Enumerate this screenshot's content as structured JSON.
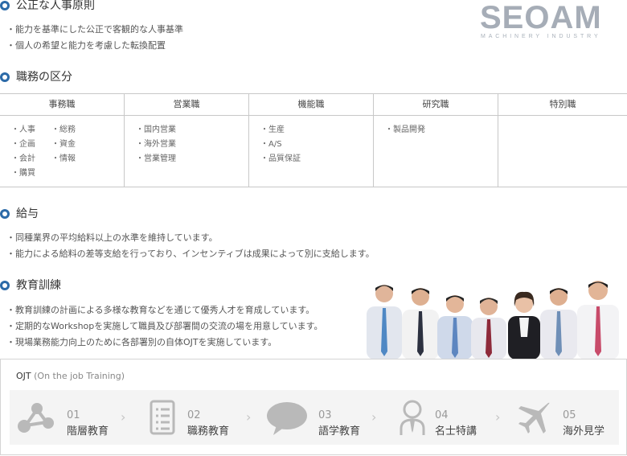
{
  "logo": {
    "word": "SEOAM",
    "sub": "MACHINERY INDUSTRY"
  },
  "principles": {
    "title": "公正な人事原則",
    "lines": [
      "・能力を基準にした公正で客観的な人事基準",
      "・個人の希望と能力を考慮した転換配置"
    ]
  },
  "jobs": {
    "title": "職務の区分",
    "columns": [
      {
        "header": "事務職",
        "items_a": [
          "・人事",
          "・企画",
          "・会計",
          "・購買"
        ],
        "items_b": [
          "・総務",
          "・資金",
          "・情報"
        ]
      },
      {
        "header": "営業職",
        "items_a": [
          "・国内営業",
          "・海外営業",
          "・営業管理"
        ]
      },
      {
        "header": "機能職",
        "items_a": [
          "・生産",
          "・A/S",
          "・品質保証"
        ]
      },
      {
        "header": "研究職",
        "items_a": [
          "・製品開発"
        ]
      },
      {
        "header": "特別職",
        "items_a": []
      }
    ]
  },
  "salary": {
    "title": "給与",
    "lines": [
      "・同種業界の平均給料以上の水準を維持しています。",
      "・能力による給料の差等支給を行っており、インセンティブは成果によって別に支給します。"
    ]
  },
  "training": {
    "title": "教育訓練",
    "lines": [
      "・教育訓練の計画による多様な教育などを通じて優秀人才を育成しています。",
      "・定期的なWorkshopを実施して職員及び部署間の交流の場を用意しています。",
      "・現場業務能力向上のために各部署別の自体OJTを実施しています。"
    ]
  },
  "ojt": {
    "title": "OJT",
    "subtitle": "(On the job Training)",
    "chevron": "›",
    "steps": [
      {
        "num": "01",
        "label": "階層教育",
        "icon": "network-icon"
      },
      {
        "num": "02",
        "label": "職務教育",
        "icon": "checklist-icon"
      },
      {
        "num": "03",
        "label": "語学教育",
        "icon": "speech-bubble-icon"
      },
      {
        "num": "04",
        "label": "名士特講",
        "icon": "person-icon"
      },
      {
        "num": "05",
        "label": "海外見学",
        "icon": "airplane-icon"
      }
    ]
  },
  "colors": {
    "accent": "#2c6aa8",
    "icon_gray": "#b9b9b9",
    "strip_bg": "#f4f4f4"
  }
}
